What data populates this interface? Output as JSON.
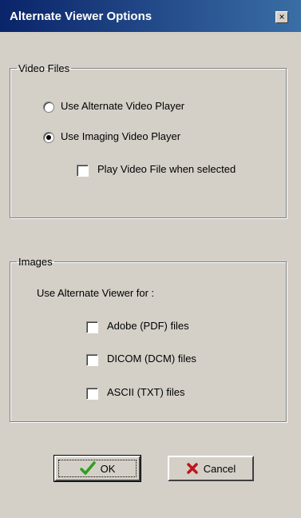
{
  "window": {
    "title": "Alternate Viewer Options",
    "close_glyph": "×"
  },
  "video_group": {
    "legend": "Video Files",
    "options": [
      {
        "label": "Use Alternate Video Player",
        "selected": false
      },
      {
        "label": "Use Imaging Video Player",
        "selected": true
      }
    ],
    "play_checkbox": {
      "label": "Play Video File when selected",
      "checked": false
    }
  },
  "images_group": {
    "legend": "Images",
    "intro": "Use Alternate Viewer for :",
    "checkboxes": [
      {
        "label": "Adobe (PDF) files",
        "checked": false
      },
      {
        "label": "DICOM (DCM) files",
        "checked": false
      },
      {
        "label": "ASCII (TXT) files",
        "checked": false
      }
    ]
  },
  "buttons": {
    "ok": {
      "label": "OK",
      "icon": "checkmark-icon",
      "icon_color": "#2e9e1f"
    },
    "cancel": {
      "label": "Cancel",
      "icon": "x-icon",
      "icon_color": "#c0141b"
    }
  }
}
